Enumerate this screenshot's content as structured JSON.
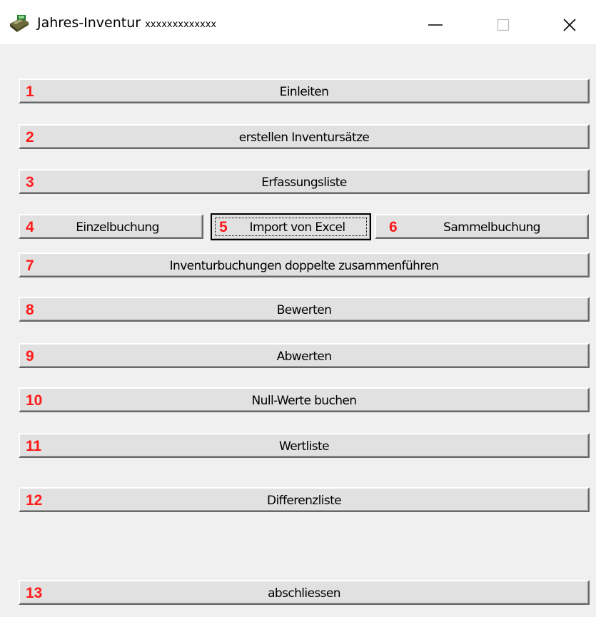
{
  "window": {
    "title": "Jahres-Inventur",
    "title_suffix": "xxxxxxxxxxxxx",
    "icon": "cash-register-icon"
  },
  "buttons": [
    {
      "num": "1",
      "label": "Einleiten"
    },
    {
      "num": "2",
      "label": "erstellen Inventursätze"
    },
    {
      "num": "3",
      "label": "Erfassungsliste"
    },
    {
      "num": "4",
      "label": "Einzelbuchung"
    },
    {
      "num": "5",
      "label": "Import von Excel"
    },
    {
      "num": "6",
      "label": "Sammelbuchung"
    },
    {
      "num": "7",
      "label": "Inventurbuchungen doppelte zusammenführen"
    },
    {
      "num": "8",
      "label": "Bewerten"
    },
    {
      "num": "9",
      "label": "Abwerten"
    },
    {
      "num": "10",
      "label": "Null-Werte buchen"
    },
    {
      "num": "11",
      "label": "Wertliste"
    },
    {
      "num": "12",
      "label": "Differenzliste"
    },
    {
      "num": "13",
      "label": "abschliessen"
    }
  ],
  "colors": {
    "number": "#ff1a1a",
    "button_face": "#e1e1e1",
    "window_bg": "#f0f0f0"
  }
}
